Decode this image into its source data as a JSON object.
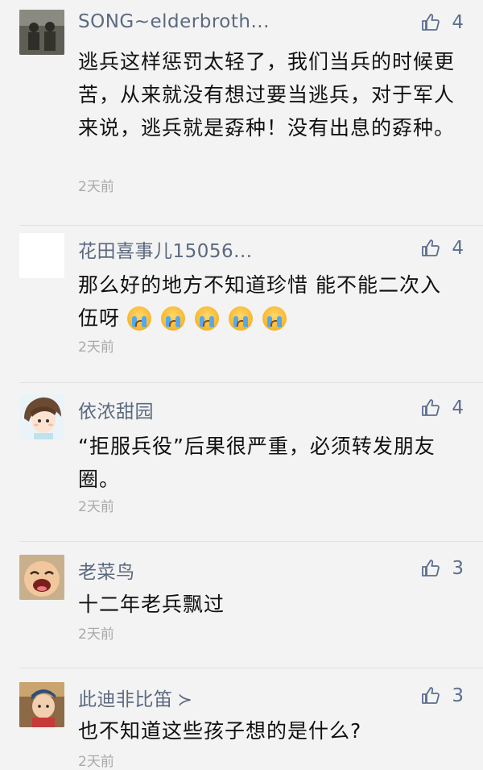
{
  "colors": {
    "name": "#5c6a7f",
    "text": "#111111",
    "time": "#a9a9a9",
    "like": "#5b6f8c",
    "background": "#f3f3f3"
  },
  "comments": [
    {
      "name": "SONG~elderbroth...",
      "likes": "4",
      "text": "逃兵这样惩罚太轻了，我们当兵的时候更苦，从来就没有想过要当逃兵，对于军人来说，逃兵就是孬种！没有出息的孬种。",
      "time": "2天前",
      "avatar_icon": "old-photo-avatar"
    },
    {
      "name": "花田喜事儿15056...",
      "likes": "4",
      "text": "那么好的地方不知道珍惜 能不能二次入伍呀",
      "emoji_icon": "crying-face-emoji",
      "emoji_count": 5,
      "time": "2天前",
      "avatar_icon": "blank-avatar"
    },
    {
      "name": "依浓甜园",
      "likes": "4",
      "text": "“拒服兵役”后果很严重，必须转发朋友圈。",
      "time": "2天前",
      "avatar_icon": "cartoon-girl-avatar"
    },
    {
      "name": "老菜鸟",
      "likes": "3",
      "text": "十二年老兵飘过",
      "time": "2天前",
      "avatar_icon": "laughing-baby-avatar"
    },
    {
      "name": "此迪非比笛",
      "name_suffix": "≻",
      "likes": "3",
      "text": "也不知道这些孩子想的是什么?",
      "time": "2天前",
      "avatar_icon": "child-photo-avatar"
    }
  ]
}
